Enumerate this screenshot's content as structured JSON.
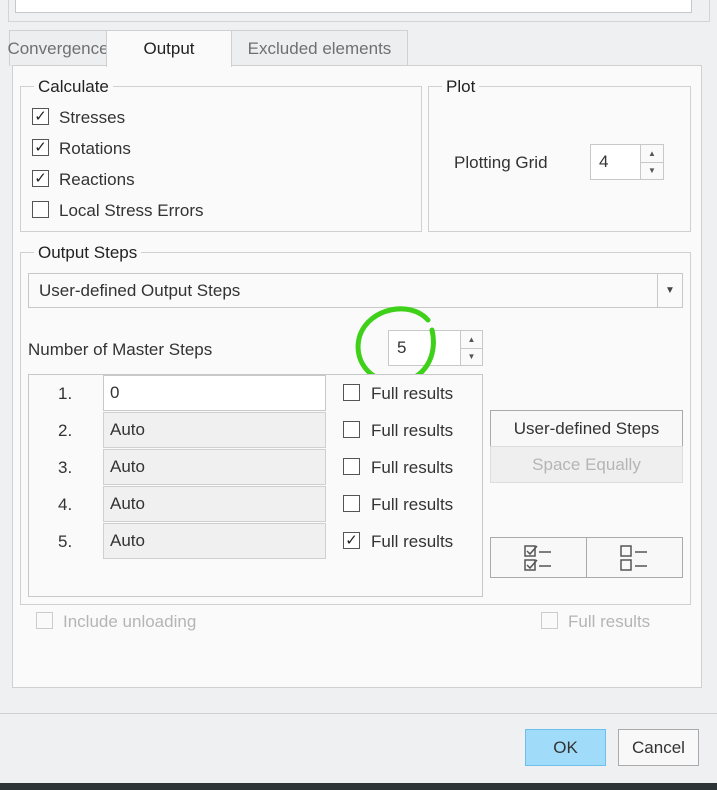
{
  "tabs": [
    {
      "label": "Convergence"
    },
    {
      "label": "Output"
    },
    {
      "label": "Excluded elements"
    }
  ],
  "calculate": {
    "title": "Calculate",
    "items": [
      {
        "label": "Stresses",
        "checked": true
      },
      {
        "label": "Rotations",
        "checked": true
      },
      {
        "label": "Reactions",
        "checked": true
      },
      {
        "label": "Local Stress Errors",
        "checked": false
      }
    ]
  },
  "plot": {
    "title": "Plot",
    "grid_label": "Plotting Grid",
    "grid_value": "4"
  },
  "output_steps": {
    "title": "Output Steps",
    "mode": "User-defined Output Steps",
    "master_label": "Number of Master Steps",
    "master_value": "5",
    "steps": [
      {
        "num": "1.",
        "value": "0",
        "full": false,
        "full_label": "Full results"
      },
      {
        "num": "2.",
        "value": "Auto",
        "full": false,
        "full_label": "Full results"
      },
      {
        "num": "3.",
        "value": "Auto",
        "full": false,
        "full_label": "Full results"
      },
      {
        "num": "4.",
        "value": "Auto",
        "full": false,
        "full_label": "Full results"
      },
      {
        "num": "5.",
        "value": "Auto",
        "full": true,
        "full_label": "Full results"
      }
    ],
    "user_defined_btn": "User-defined Steps",
    "space_equally_btn": "Space Equally"
  },
  "include_unloading": "Include unloading",
  "full_results": "Full results",
  "footer": {
    "ok": "OK",
    "cancel": "Cancel"
  },
  "check_mark": "✓",
  "arrow_up": "▲",
  "arrow_down": "▼",
  "dropdown_arrow": "▼"
}
